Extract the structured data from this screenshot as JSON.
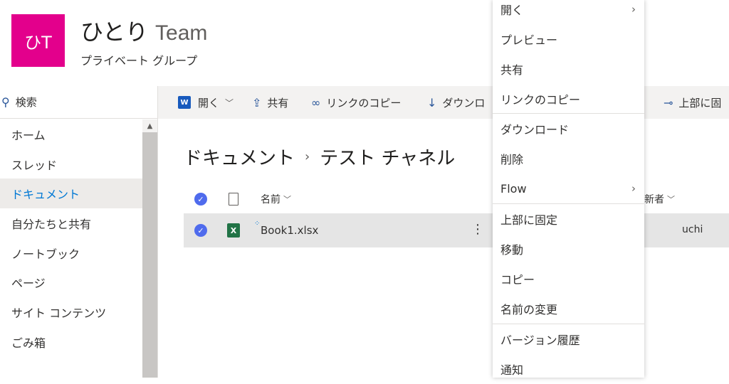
{
  "site": {
    "logo_text": "ひT",
    "title": "ひとり",
    "title_suffix": "Team",
    "subtitle": "プライベート グループ",
    "logo_color": "#e3008c"
  },
  "search": {
    "label": "検索",
    "icon": "search-icon"
  },
  "nav": [
    {
      "label": "ホーム"
    },
    {
      "label": "スレッド"
    },
    {
      "label": "ドキュメント",
      "active": true
    },
    {
      "label": "自分たちと共有"
    },
    {
      "label": "ノートブック"
    },
    {
      "label": "ページ"
    },
    {
      "label": "サイト コンテンツ"
    },
    {
      "label": "ごみ箱"
    }
  ],
  "commands": {
    "open": "開く",
    "share": "共有",
    "copy_link": "リンクのコピー",
    "download": "ダウンロ",
    "pin": "上部に固"
  },
  "breadcrumb": {
    "root": "ドキュメント",
    "current": "テスト チャネル"
  },
  "columns": {
    "name": "名前",
    "modified_by": "新者"
  },
  "file": {
    "name": "Book1.xlsx",
    "modified_by": "uzaki Tauchi"
  },
  "context_menu": [
    {
      "label": "開く",
      "submenu": true
    },
    {
      "label": "プレビュー"
    },
    {
      "label": "共有"
    },
    {
      "label": "リンクのコピー"
    },
    {
      "label": "ダウンロード"
    },
    {
      "label": "削除"
    },
    {
      "label": "Flow",
      "submenu": true
    },
    {
      "label": "上部に固定"
    },
    {
      "label": "移動"
    },
    {
      "label": "コピー"
    },
    {
      "label": "名前の変更"
    },
    {
      "label": "バージョン履歴"
    },
    {
      "label": "通知"
    }
  ],
  "colors": {
    "accent": "#0078d4",
    "check": "#4f6bed",
    "excel": "#217346"
  }
}
